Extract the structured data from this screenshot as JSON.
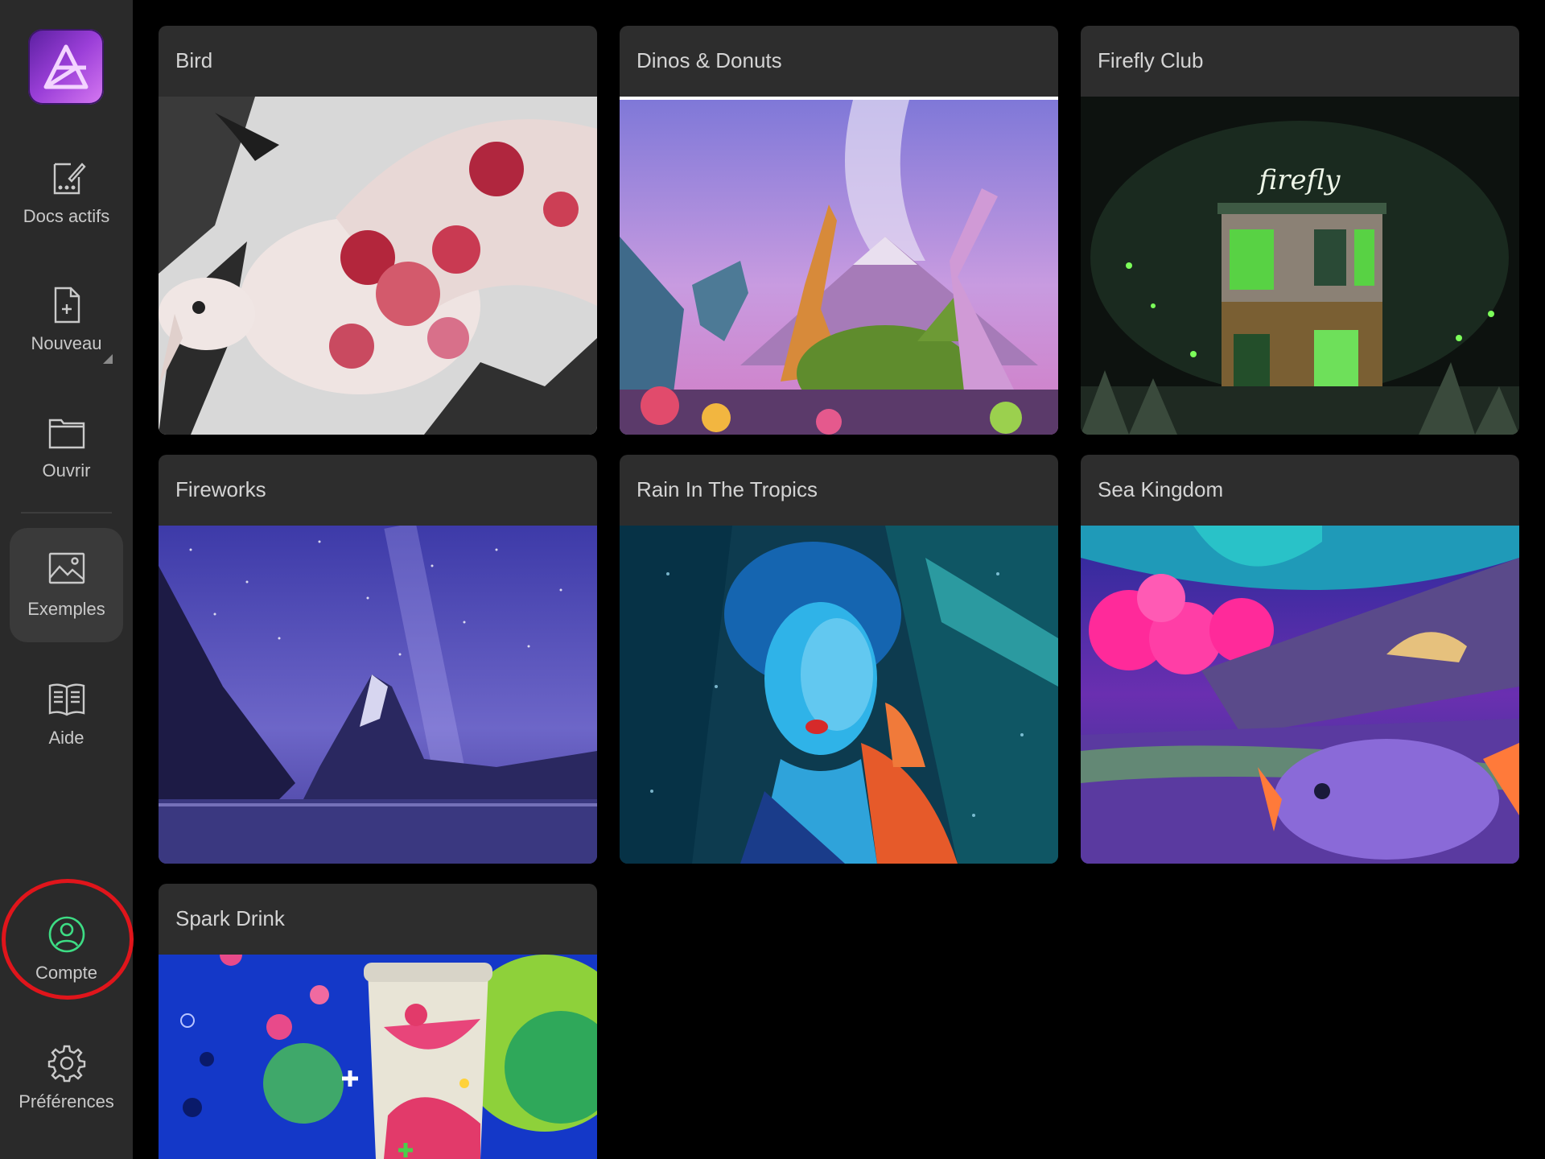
{
  "sidebar": {
    "items": [
      {
        "label": "Docs actifs",
        "icon": "active-docs-icon"
      },
      {
        "label": "Nouveau",
        "icon": "new-document-icon"
      },
      {
        "label": "Ouvrir",
        "icon": "folder-icon"
      },
      {
        "label": "Exemples",
        "icon": "image-icon",
        "selected": true
      },
      {
        "label": "Aide",
        "icon": "book-icon"
      },
      {
        "label": "Compte",
        "icon": "account-icon",
        "accent": "#3ddc84"
      },
      {
        "label": "Préférences",
        "icon": "gear-icon"
      }
    ],
    "highlight_color": "#e0151b"
  },
  "samples": [
    {
      "title": "Bird"
    },
    {
      "title": "Dinos & Donuts"
    },
    {
      "title": "Firefly Club"
    },
    {
      "title": "Fireworks"
    },
    {
      "title": "Rain In The Tropics"
    },
    {
      "title": "Sea Kingdom"
    },
    {
      "title": "Spark Drink"
    }
  ],
  "colors": {
    "background": "#000000",
    "sidebar": "#2a2a2a",
    "card": "#2d2d2d",
    "selected_item": "#3a3a3a"
  }
}
